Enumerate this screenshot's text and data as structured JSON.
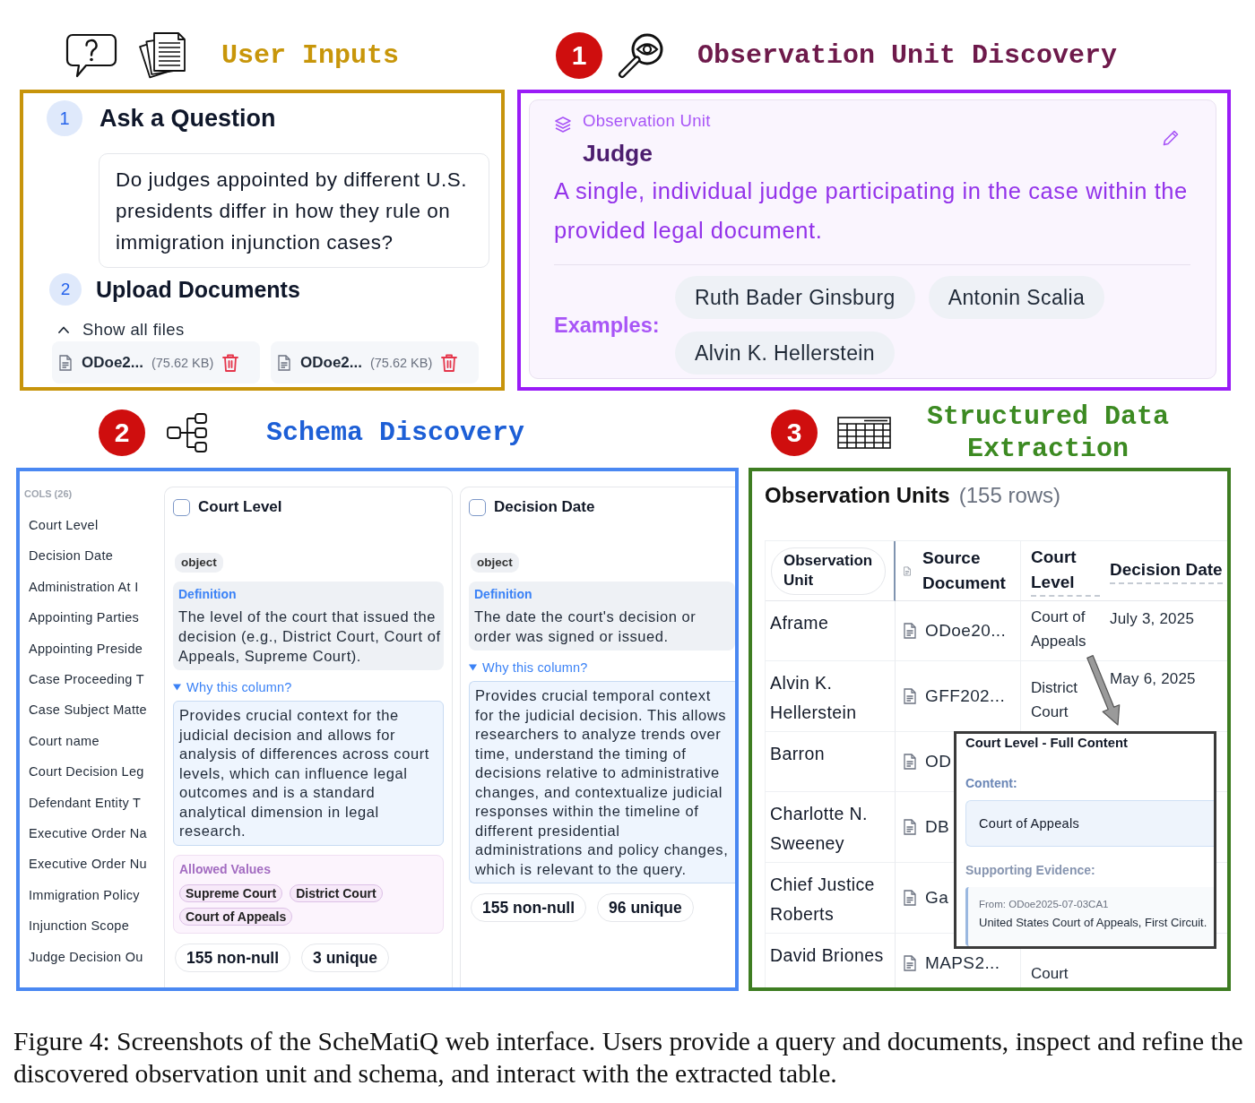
{
  "user_inputs": {
    "heading": "User Inputs",
    "ask": {
      "step": "1",
      "title": "Ask a Question",
      "question": "Do judges appointed by different U.S. presidents differ in how they rule on immigration injunction cases?"
    },
    "upload": {
      "step": "2",
      "title": "Upload Documents",
      "toggle": {
        "label": "Show all files",
        "expanded": true
      },
      "files": [
        {
          "name": "ODoe2...",
          "size": "(75.62 KB)"
        },
        {
          "name": "ODoe2...",
          "size": "(75.62 KB)"
        }
      ]
    }
  },
  "observation_unit_discovery": {
    "step": "1",
    "heading": "Observation Unit Discovery",
    "card": {
      "label": "Observation Unit",
      "name": "Judge",
      "description": "A single, individual judge participating in the case within the provided legal document.",
      "examples_label": "Examples:",
      "examples": [
        "Ruth Bader Ginsburg",
        "Antonin Scalia",
        "Alvin K. Hellerstein"
      ]
    }
  },
  "schema_discovery": {
    "step": "2",
    "heading": "Schema Discovery",
    "sidebar": {
      "title": "COLS (26)",
      "items": [
        "Court Level",
        "Decision Date",
        "Administration At I",
        "Appointing Parties",
        "Appointing Preside",
        "Case Proceeding T",
        "Case Subject Matte",
        "Court name",
        "Court Decision Leg",
        "Defendant Entity T",
        "Executive Order Na",
        "Executive Order Nu",
        "Immigration Policy",
        "Injunction Scope",
        "Judge Decision Ou"
      ]
    },
    "columns": [
      {
        "name": "Court Level",
        "checked": false,
        "type": "object",
        "definition_label": "Definition",
        "definition": "The level of the court that issued the decision (e.g., District Court, Court of Appeals, Supreme Court).",
        "why_label": "Why this column?",
        "why_expanded": true,
        "rationale": "Provides crucial context for the judicial decision and allows for analysis of differences across court levels, which can influence legal outcomes and is a standard analytical dimension in legal research.",
        "allowed_values_label": "Allowed Values",
        "allowed_values": [
          "Supreme Court",
          "District Court",
          "Court of Appeals"
        ],
        "stats": [
          "155 non-null",
          "3 unique"
        ]
      },
      {
        "name": "Decision Date",
        "checked": false,
        "type": "object",
        "definition_label": "Definition",
        "definition": "The date the court's decision or order was signed or issued.",
        "why_label": "Why this column?",
        "why_expanded": true,
        "rationale": "Provides crucial temporal context for the judicial decision. This allows researchers to analyze trends over time, understand the timing of decisions relative to administrative changes, and contextualize judicial responses within the timeline of different presidential administrations and policy changes, which is relevant to the query.",
        "stats": [
          "155 non-null",
          "96 unique"
        ]
      }
    ]
  },
  "structured_data_extraction": {
    "step": "3",
    "heading": "Structured Data Extraction",
    "table": {
      "title": "Observation Units",
      "count": "(155 rows)",
      "columns": [
        {
          "label": "Observation Unit",
          "kind": "pinned"
        },
        {
          "label": "Source Document",
          "kind": "document"
        },
        {
          "label": "Court Level",
          "kind": "field"
        },
        {
          "label": "Decision Date",
          "kind": "field"
        }
      ],
      "rows": [
        {
          "unit": "Aframe",
          "source": "ODoe20...",
          "court_level": "Court of Appeals",
          "decision_date": "July 3, 2025"
        },
        {
          "unit": "Alvin K. Hellerstein",
          "source": "GFF202...",
          "court_level": "District Court",
          "decision_date": "May 6, 2025"
        },
        {
          "unit": "Barron",
          "source": "OD"
        },
        {
          "unit": "Charlotte N. Sweeney",
          "source": "DB"
        },
        {
          "unit": "Chief Justice Roberts",
          "source": "Ga"
        },
        {
          "unit": "David Briones",
          "source": "MAPS2...",
          "court_level": "Court"
        }
      ]
    },
    "popup": {
      "title": "Court Level - Full Content",
      "content_label": "Content:",
      "content": "Court of Appeals",
      "evidence_label": "Supporting Evidence:",
      "evidence_source": "From: ODoe2025-07-03CA1",
      "evidence_text": "United States Court of Appeals, First Circuit."
    }
  },
  "caption": "Figure 4: Screenshots of the ScheMatiQ web interface. Users provide a query and documents, inspect and refine the discovered observation unit and schema, and interact with the extracted table."
}
